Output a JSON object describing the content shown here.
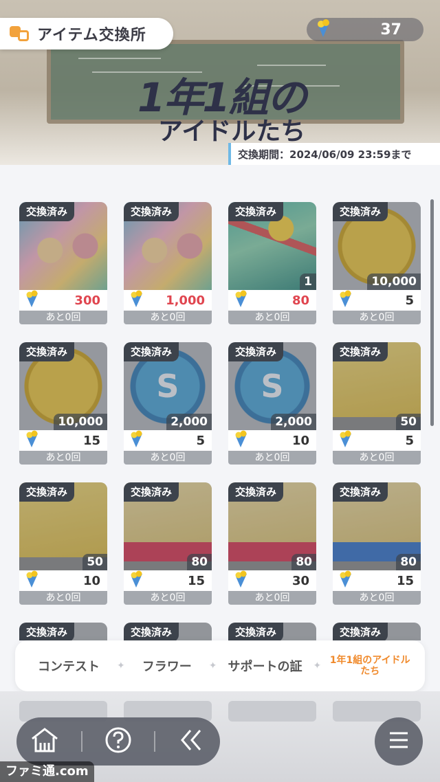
{
  "header": {
    "title": "アイテム交換所",
    "currency_amount": "37",
    "event_logo_line1": "1年1組の",
    "event_logo_line2": "アイドルたち",
    "period": "交換期間：2024/06/09 23:59まで"
  },
  "items": [
    {
      "badge": "交換済み",
      "kind": "card-art",
      "qty": "",
      "price": "300",
      "price_red": true,
      "remaining": "あと0回"
    },
    {
      "badge": "交換済み",
      "kind": "card-art",
      "qty": "",
      "price": "1,000",
      "price_red": true,
      "remaining": "あと0回"
    },
    {
      "badge": "交換済み",
      "kind": "gift-book",
      "qty": "1",
      "price": "80",
      "price_red": true,
      "remaining": "あと0回"
    },
    {
      "badge": "交換済み",
      "kind": "gold-coin",
      "qty": "10,000",
      "price": "5",
      "price_red": false,
      "remaining": "あと0回"
    },
    {
      "badge": "交換済み",
      "kind": "gold-coin",
      "qty": "10,000",
      "price": "15",
      "price_red": false,
      "remaining": "あと0回"
    },
    {
      "badge": "交換済み",
      "kind": "s-medal",
      "qty": "2,000",
      "price": "5",
      "price_red": false,
      "remaining": "あと0回"
    },
    {
      "badge": "交換済み",
      "kind": "s-medal",
      "qty": "2,000",
      "price": "10",
      "price_red": false,
      "remaining": "あと0回"
    },
    {
      "badge": "交換済み",
      "kind": "yellow-book",
      "qty": "50",
      "price": "5",
      "price_red": false,
      "remaining": "あと0回"
    },
    {
      "badge": "交換済み",
      "kind": "yellow-book",
      "qty": "50",
      "price": "10",
      "price_red": false,
      "remaining": "あと0回"
    },
    {
      "badge": "交換済み",
      "kind": "red-book",
      "qty": "80",
      "price": "15",
      "price_red": false,
      "remaining": "あと0回"
    },
    {
      "badge": "交換済み",
      "kind": "red-book",
      "qty": "80",
      "price": "30",
      "price_red": false,
      "remaining": "あと0回"
    },
    {
      "badge": "交換済み",
      "kind": "blue-book",
      "qty": "80",
      "price": "15",
      "price_red": false,
      "remaining": "あと0回"
    },
    {
      "badge": "交換済み",
      "kind": "partial",
      "qty": "",
      "price": "",
      "price_red": false,
      "remaining": ""
    },
    {
      "badge": "交換済み",
      "kind": "partial",
      "qty": "",
      "price": "",
      "price_red": false,
      "remaining": ""
    },
    {
      "badge": "交換済み",
      "kind": "partial",
      "qty": "",
      "price": "",
      "price_red": false,
      "remaining": ""
    },
    {
      "badge": "交換済み",
      "kind": "partial",
      "qty": "",
      "price": "",
      "price_red": false,
      "remaining": ""
    }
  ],
  "tabs": [
    {
      "label": "コンテスト",
      "active": false
    },
    {
      "label": "フラワー",
      "active": false
    },
    {
      "label": "サポートの証",
      "active": false
    },
    {
      "label": "1年1組のアイドルたち",
      "active": true
    }
  ],
  "watermark": "ファミ通.com",
  "colors": {
    "accent": "#f08a2c",
    "price_red": "#e0454f",
    "badge_bg": "#3d434c"
  },
  "icons": {
    "currency": "ice-cream-cone-icon",
    "home": "home-icon",
    "help": "help-icon",
    "back": "back-chevrons-icon",
    "menu": "menu-icon"
  }
}
